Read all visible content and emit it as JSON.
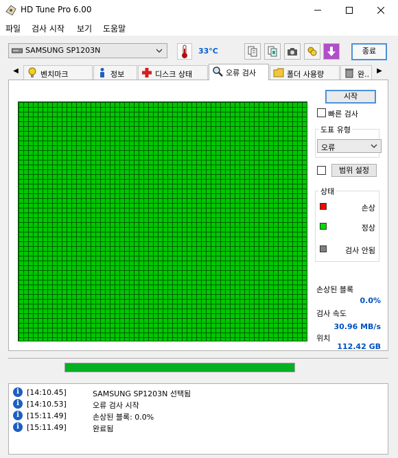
{
  "window": {
    "title": "HD Tune Pro 6.00",
    "controls": [
      "minimize",
      "maximize",
      "close"
    ]
  },
  "menu": [
    "파일",
    "검사 시작",
    "보기",
    "도움말"
  ],
  "toolbar": {
    "drive": "SAMSUNG SP1203N",
    "temperature": "33°C",
    "exit_label": "종료",
    "icons": [
      "copy-text-icon",
      "copy-screenshot-icon",
      "camera-icon",
      "coins-icon",
      "download-icon"
    ]
  },
  "tabs": {
    "items": [
      {
        "label": "벤치마크",
        "icon": "bulb-icon"
      },
      {
        "label": "정보",
        "icon": "info-person-icon"
      },
      {
        "label": "디스크 상태",
        "icon": "health-cross-icon"
      },
      {
        "label": "오류 검사",
        "icon": "magnifier-icon",
        "active": true
      },
      {
        "label": "폴더 사용량",
        "icon": "folder-icon"
      },
      {
        "label": "완..",
        "icon": "trash-icon"
      }
    ]
  },
  "error_scan": {
    "start_label": "시작",
    "quick_scan_label": "빠른 검사",
    "quick_scan_checked": false,
    "map_type_title": "도표 유형",
    "map_type_value": "오류",
    "range_checked": false,
    "range_label": "범위 설정",
    "status_title": "상태",
    "legend": [
      {
        "label": "손상",
        "color": "#ff0000"
      },
      {
        "label": "정상",
        "color": "#00dd00"
      },
      {
        "label": "검사 안됨",
        "color": "#808080"
      }
    ],
    "damaged_blocks_label": "손상된 블록",
    "damaged_blocks_value": "0.0%",
    "scan_speed_label": "검사 속도",
    "scan_speed_value": "30.96 MB/s",
    "position_label": "위치",
    "position_value": "112.42 GB",
    "block_status": "all-ok",
    "progress_percent": 100
  },
  "log": [
    {
      "time": "[14:10.45]",
      "message": "SAMSUNG SP1203N 선택됨"
    },
    {
      "time": "[14:10.53]",
      "message": "오류 검사 시작"
    },
    {
      "time": "[15:11.49]",
      "message": "손상된 블록: 0.0%"
    },
    {
      "time": "[15:11.49]",
      "message": "완료됨"
    }
  ]
}
